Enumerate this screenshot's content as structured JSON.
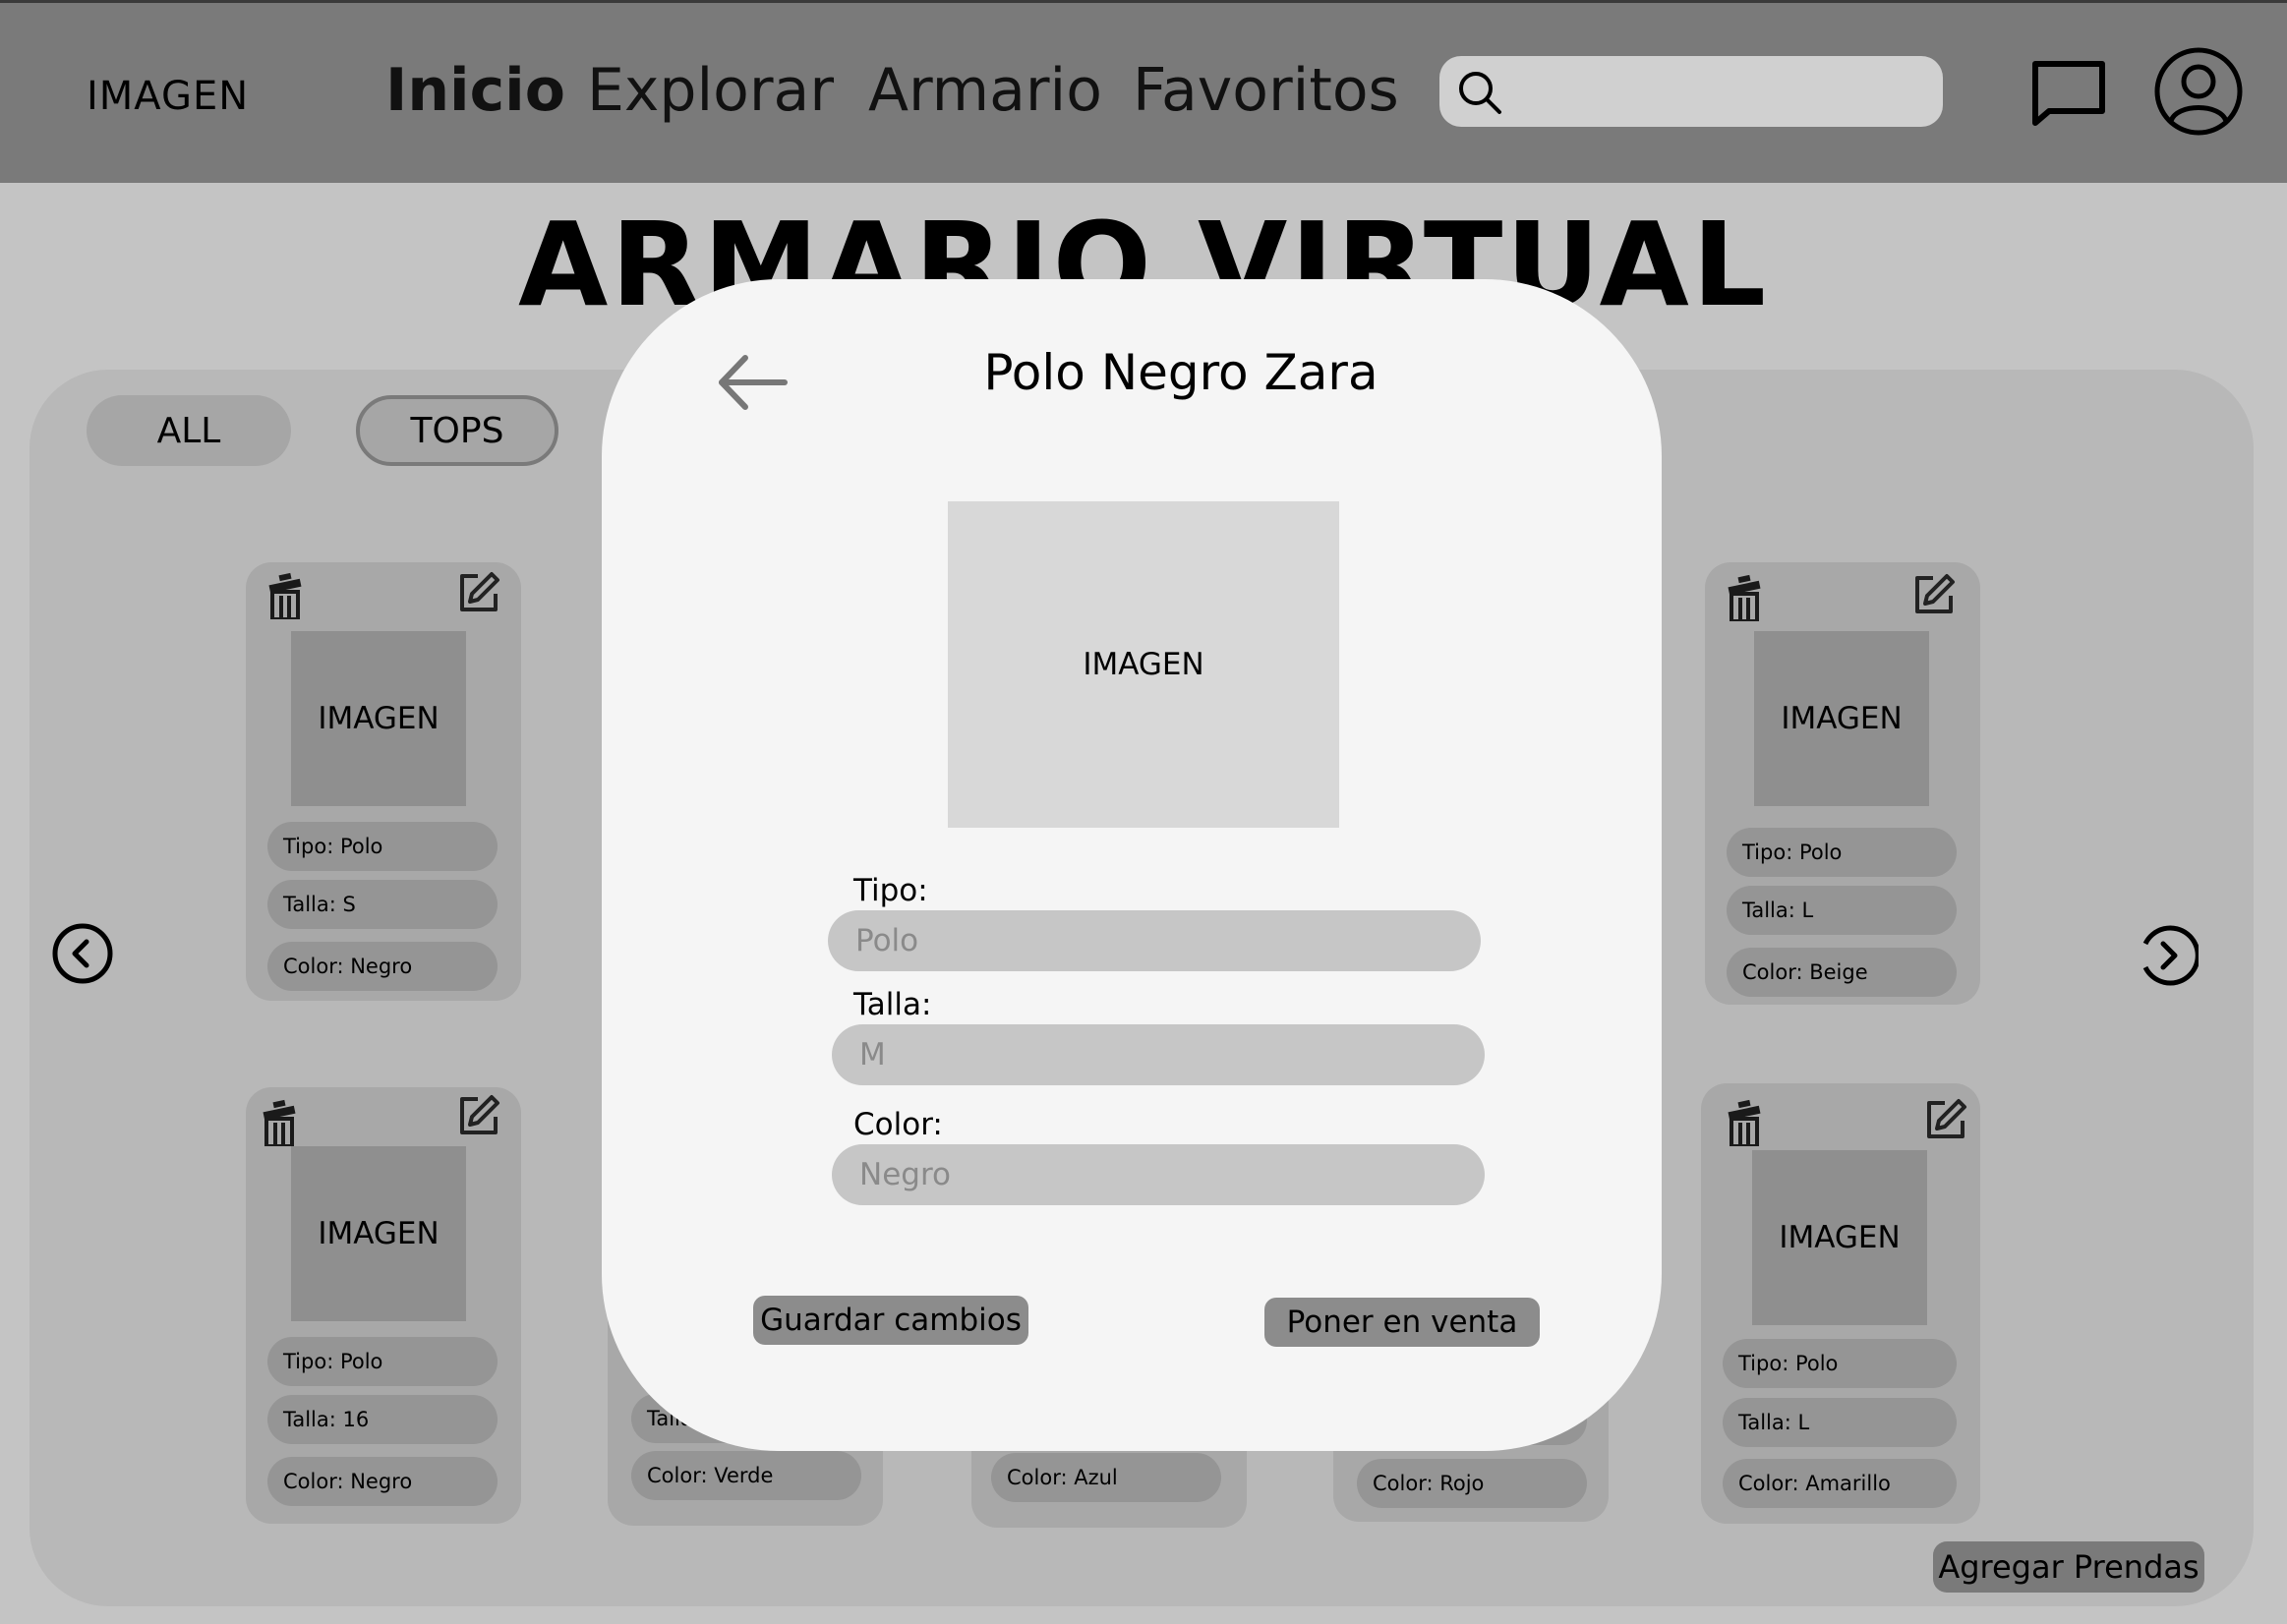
{
  "header": {
    "logo": "IMAGEN",
    "nav": [
      "Inicio",
      "Explorar",
      "Armario",
      "Favoritos"
    ],
    "search_placeholder": ""
  },
  "page": {
    "title": "ARMARIO VIRTUAL"
  },
  "filters": [
    "ALL",
    "TOPS"
  ],
  "cards": [
    {
      "image": "IMAGEN",
      "tipo": "Tipo: Polo",
      "talla": "Talla: S",
      "color": "Color: Negro"
    },
    {
      "image": "IMAGEN",
      "tipo": "Tipo: Polo",
      "talla": "Talla: L",
      "color": "Color: Beige"
    },
    {
      "image": "IMAGEN",
      "tipo": "Tipo: Polo",
      "talla": "Talla: 16",
      "color": "Color: Negro"
    },
    {
      "talla": "Talla: ",
      "color": "Color: Verde"
    },
    {
      "color": "Color: Azul"
    },
    {
      "color": "Color: Rojo"
    },
    {
      "image": "IMAGEN",
      "tipo": "Tipo: Polo",
      "talla": "Talla: L",
      "color": "Color: Amarillo"
    }
  ],
  "add_button": "Agregar Prendas",
  "modal": {
    "title": "Polo Negro Zara",
    "image": "IMAGEN",
    "fields": [
      {
        "label": "Tipo:",
        "value": "Polo"
      },
      {
        "label": "Talla:",
        "value": "M"
      },
      {
        "label": "Color:",
        "value": "Negro"
      }
    ],
    "save_button": "Guardar cambios",
    "sell_button": "Poner en venta"
  }
}
